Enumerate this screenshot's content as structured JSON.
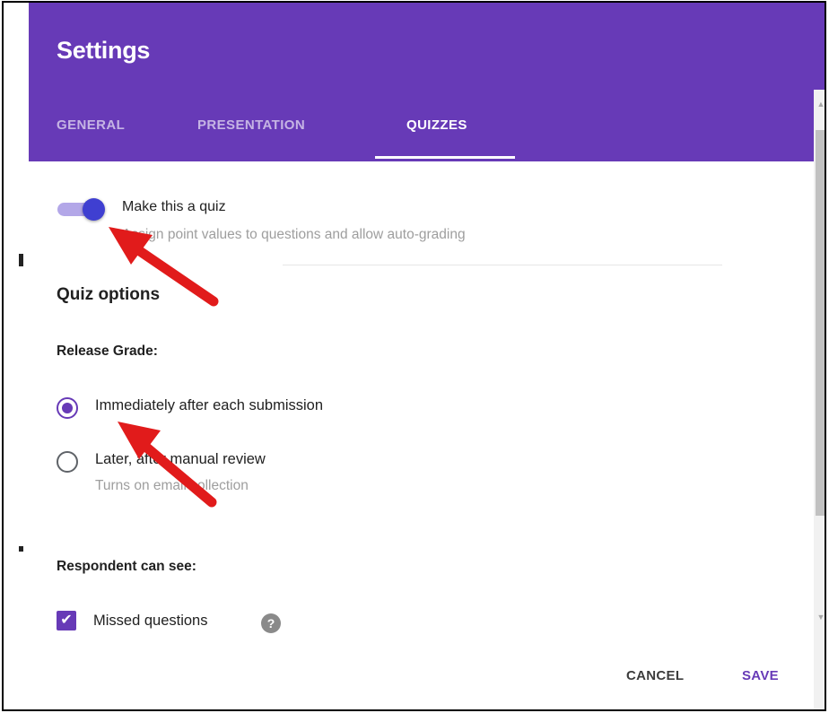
{
  "dialog": {
    "title": "Settings",
    "tabs": [
      {
        "label": "GENERAL",
        "active": false
      },
      {
        "label": "PRESENTATION",
        "active": false
      },
      {
        "label": "QUIZZES",
        "active": true
      }
    ]
  },
  "quiz_toggle": {
    "label": "Make this a quiz",
    "description": "Assign point values to questions and allow auto-grading",
    "on": true
  },
  "quiz_options": {
    "heading": "Quiz options",
    "release_grade": {
      "label": "Release Grade:",
      "options": [
        {
          "label": "Immediately after each submission",
          "sublabel": "",
          "checked": true
        },
        {
          "label": "Later, after manual review",
          "sublabel": "Turns on email collection",
          "checked": false
        }
      ]
    },
    "respondent_can_see": {
      "label": "Respondent can see:",
      "items": [
        {
          "label": "Missed questions",
          "checked": true
        }
      ]
    }
  },
  "buttons": {
    "cancel": "CANCEL",
    "save": "SAVE"
  },
  "colors": {
    "accent": "#673ab7",
    "annotation_arrow": "#e11b1b"
  },
  "icons": {
    "help": "help-circle-icon",
    "check": "checkmark-icon"
  }
}
